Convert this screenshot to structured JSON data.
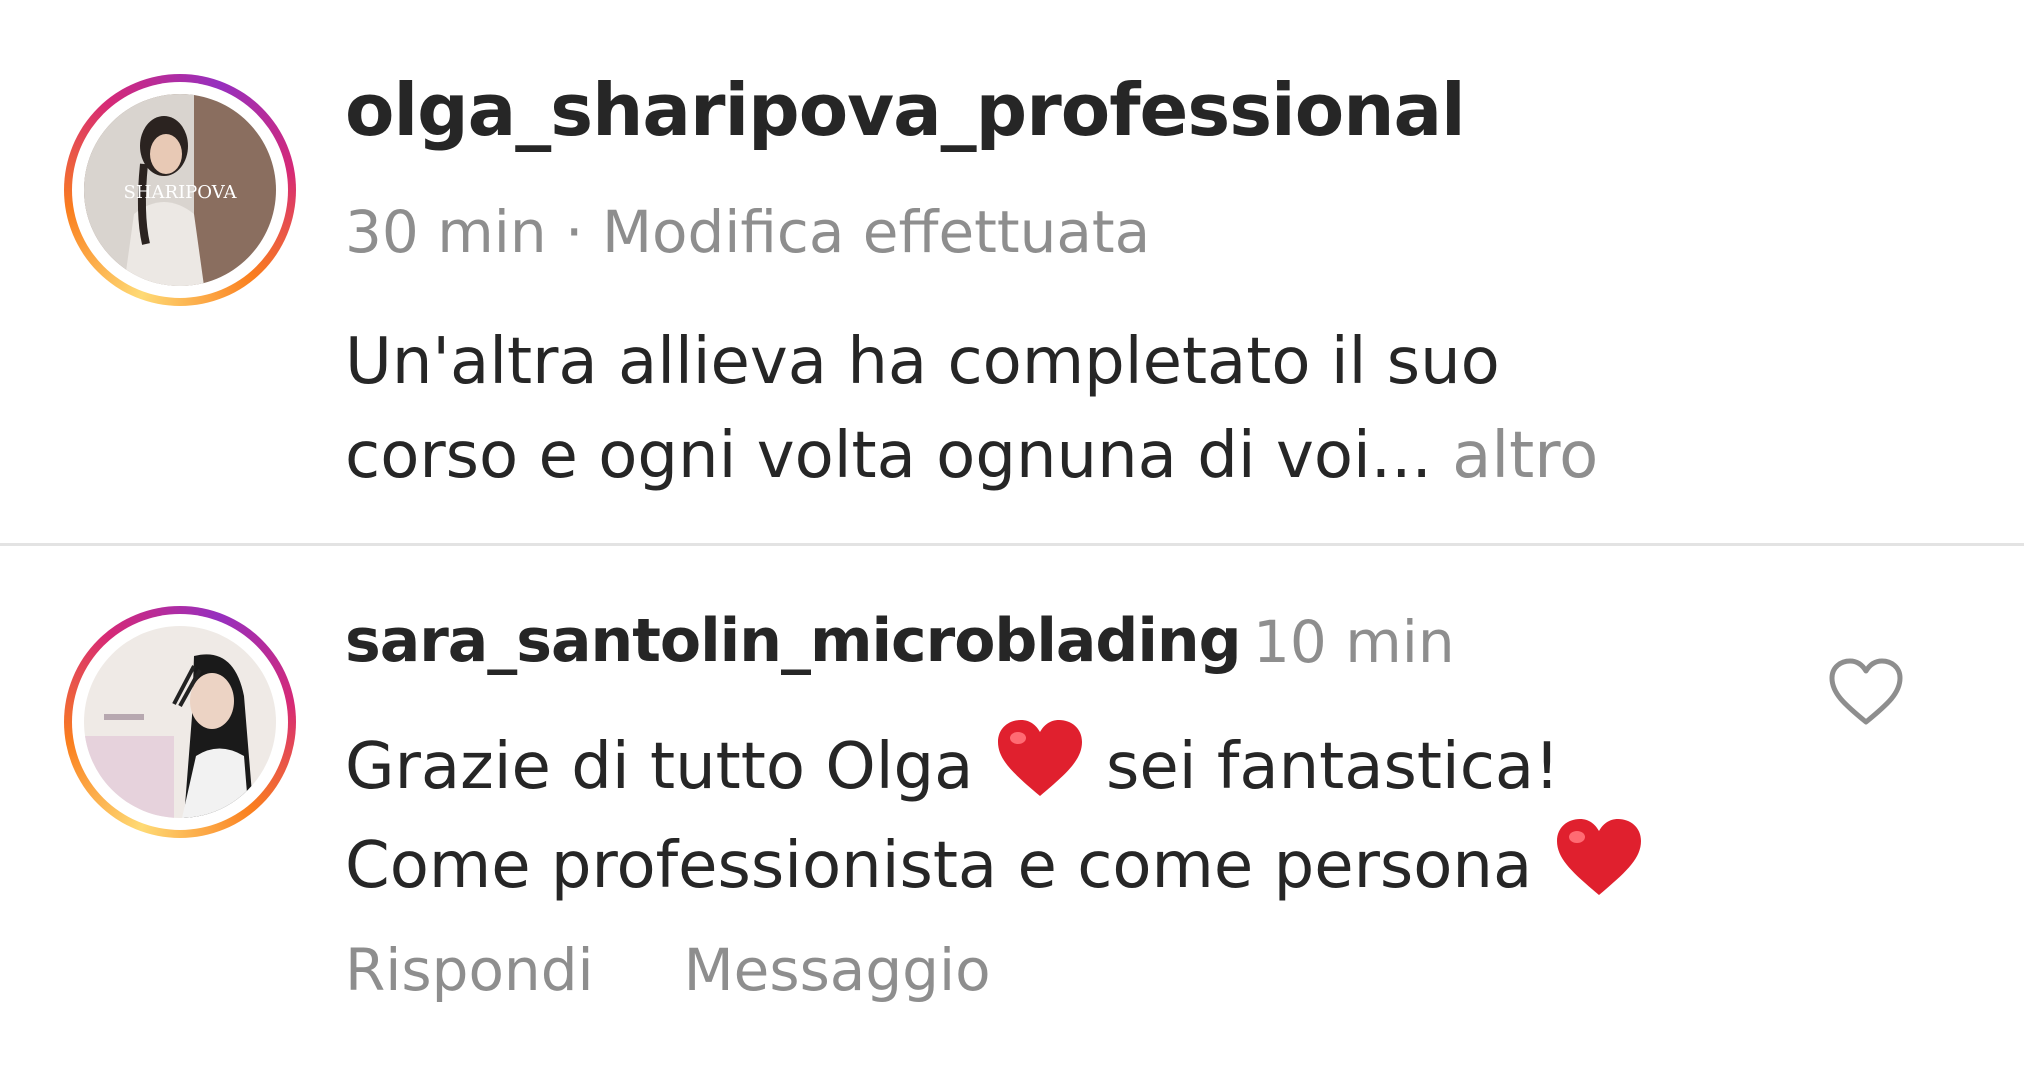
{
  "post": {
    "author": "olga_sharipova_professional",
    "avatar_text": "SHARIPOVA",
    "time": "30 min",
    "separator": " · ",
    "edited": "Modifica effettuata",
    "caption_line1": "Un'altra allieva ha completato il suo",
    "caption_line2": "corso e ogni volta ognuna di voi...",
    "more": " altro"
  },
  "comment": {
    "author": "sara_santolin_microblading",
    "time": "10 min",
    "text_part1": "Grazie di tutto Olga ",
    "text_part2": " sei fantastica!",
    "text_part3": "Come professionista e come persona ",
    "reply": "Rispondi",
    "message": "Messaggio",
    "like_icon": "heart-outline-icon",
    "emoji": "red-heart"
  },
  "colors": {
    "text": "#262626",
    "secondary": "#8e8e8e",
    "divider": "#e3e3e3",
    "heart": "#e0202e"
  }
}
